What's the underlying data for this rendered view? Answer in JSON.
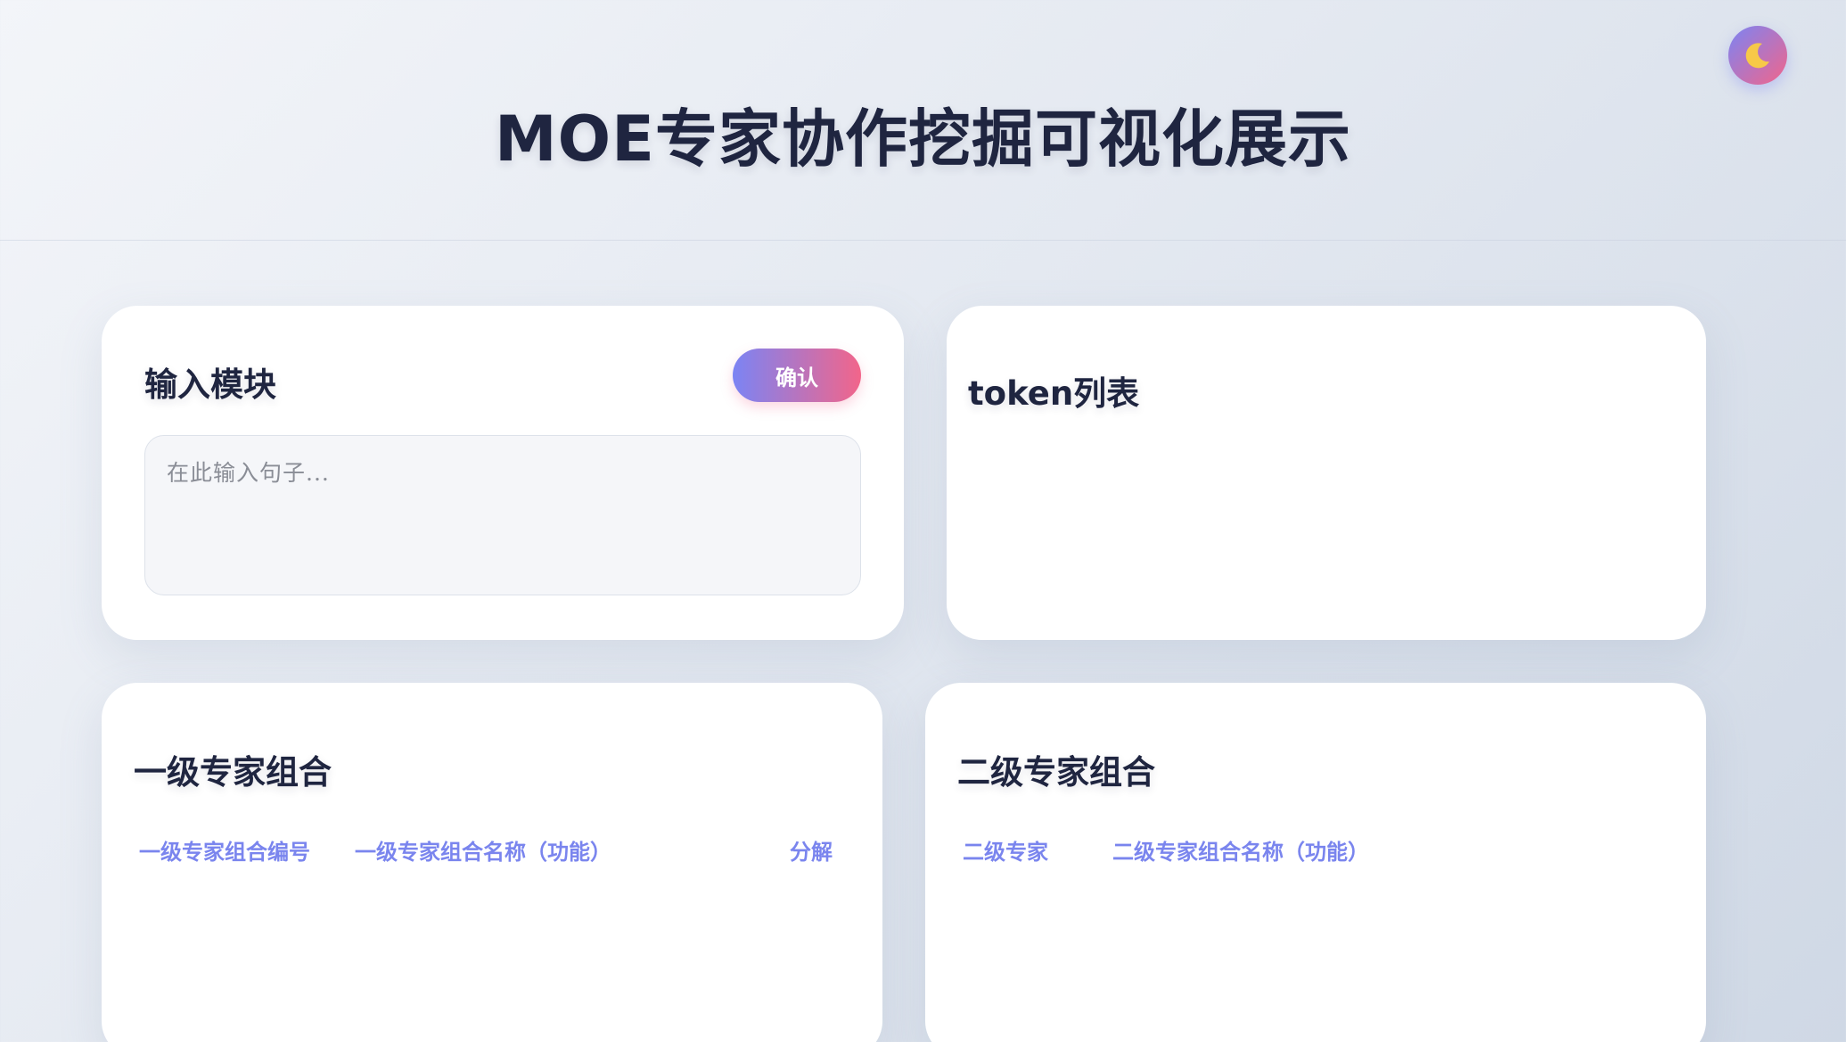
{
  "header": {
    "title": "MOE专家协作挖掘可视化展示",
    "theme_toggle_icon": "moon-icon"
  },
  "input_module": {
    "title": "输入模块",
    "confirm_label": "确认",
    "sentence_placeholder": "在此输入句子...",
    "sentence_value": ""
  },
  "token_list": {
    "title": "token列表",
    "tokens": []
  },
  "level1": {
    "title": "一级专家组合",
    "columns": [
      "一级专家组合编号",
      "一级专家组合名称（功能）",
      "分解"
    ],
    "rows": []
  },
  "level2": {
    "title": "二级专家组合",
    "columns": [
      "二级专家",
      "二级专家组合名称（功能）"
    ],
    "rows": []
  },
  "colors": {
    "title_text": "#1f2540",
    "accent_start": "#7b84f4",
    "accent_end": "#f2658a",
    "column_header": "#7a85ee",
    "moon": "#f7c948"
  }
}
